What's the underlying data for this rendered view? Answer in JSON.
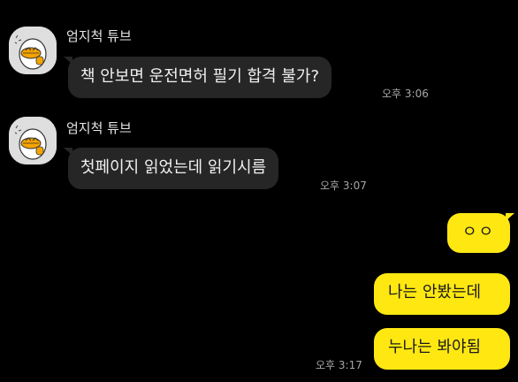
{
  "colors": {
    "background": "#000000",
    "incoming_bubble": "#262626",
    "outgoing_bubble": "#ffe812",
    "timestamp": "#a6a6a6"
  },
  "messages": [
    {
      "sender": "엄지척 튜브",
      "avatar_icon": "tube-duck-thumbs-up-icon",
      "text": "책 안보면 운전면허 필기 합격 불가?",
      "time": "오후 3:06"
    },
    {
      "sender": "엄지척 튜브",
      "avatar_icon": "tube-duck-thumbs-up-icon",
      "text": "첫페이지 읽었는데 읽기시름",
      "time": "오후 3:07"
    },
    {
      "text": "ㅇㅇ"
    },
    {
      "text": "나는 안봤는데"
    },
    {
      "text": "누나는 봐야됨",
      "time": "오후 3:17"
    }
  ]
}
